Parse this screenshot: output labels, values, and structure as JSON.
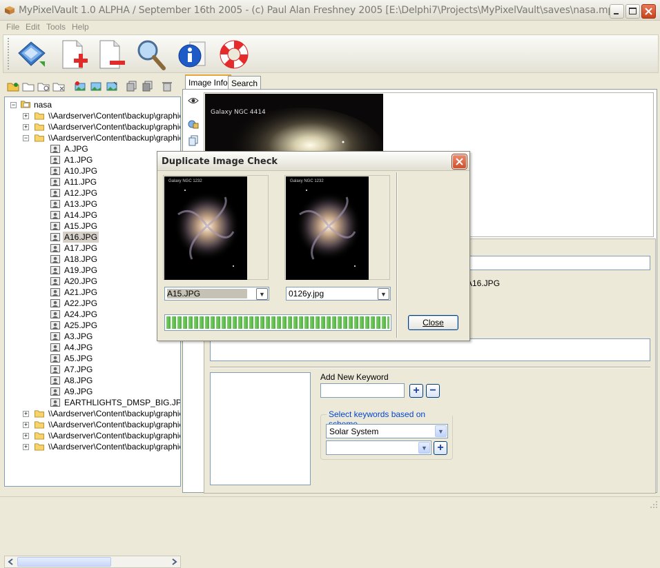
{
  "window": {
    "title": "MyPixelVault 1.0 ALPHA / September 16th 2005 - (c) Paul Alan Freshney 2005     [E:\\Delphi7\\Projects\\MyPixelVault\\saves\\nasa.mpv]"
  },
  "menu": [
    "File",
    "Edit",
    "Tools",
    "Help"
  ],
  "toolbar": {
    "buttons": [
      "open-vault-icon",
      "add-image-icon",
      "remove-image-icon",
      "search-icon",
      "info-icon",
      "help-lifebuoy-icon"
    ]
  },
  "tree": {
    "root": "nasa",
    "folder_path": "\\\\Aardserver\\Content\\backup\\graphics",
    "files": [
      "A.JPG",
      "A1.JPG",
      "A10.JPG",
      "A11.JPG",
      "A12.JPG",
      "A13.JPG",
      "A14.JPG",
      "A15.JPG",
      "A16.JPG",
      "A17.JPG",
      "A18.JPG",
      "A19.JPG",
      "A20.JPG",
      "A21.JPG",
      "A22.JPG",
      "A24.JPG",
      "A25.JPG",
      "A3.JPG",
      "A4.JPG",
      "A5.JPG",
      "A7.JPG",
      "A8.JPG",
      "A9.JPG",
      "EARTHLIGHTS_DMSP_BIG.JPG"
    ],
    "selected": "A16.JPG"
  },
  "tabs": [
    "Image Info",
    "Search"
  ],
  "image_info": {
    "preview_caption": "Galaxy NGC 4414",
    "filename_partial": "A16.JPG",
    "add_keyword_label": "Add New Keyword",
    "keyword_input": "",
    "scheme_group_label": "Select keywords based on scheme",
    "scheme_selected": "Solar System",
    "scheme_keyword_selected": ""
  },
  "dialog": {
    "title": "Duplicate Image Check",
    "left_image_caption": "Galaxy NGC 1232",
    "right_image_caption": "Galaxy NGC 1232",
    "left_file": "A15.JPG",
    "right_file": "0126y.jpg",
    "progress": 1.0,
    "close_label": "Close",
    "close_accel": "C",
    "close_rest": "lose"
  },
  "colors": {
    "accent_tab": "#e8a33a",
    "progress_green": "#55b744",
    "group_label": "#0046d5"
  }
}
